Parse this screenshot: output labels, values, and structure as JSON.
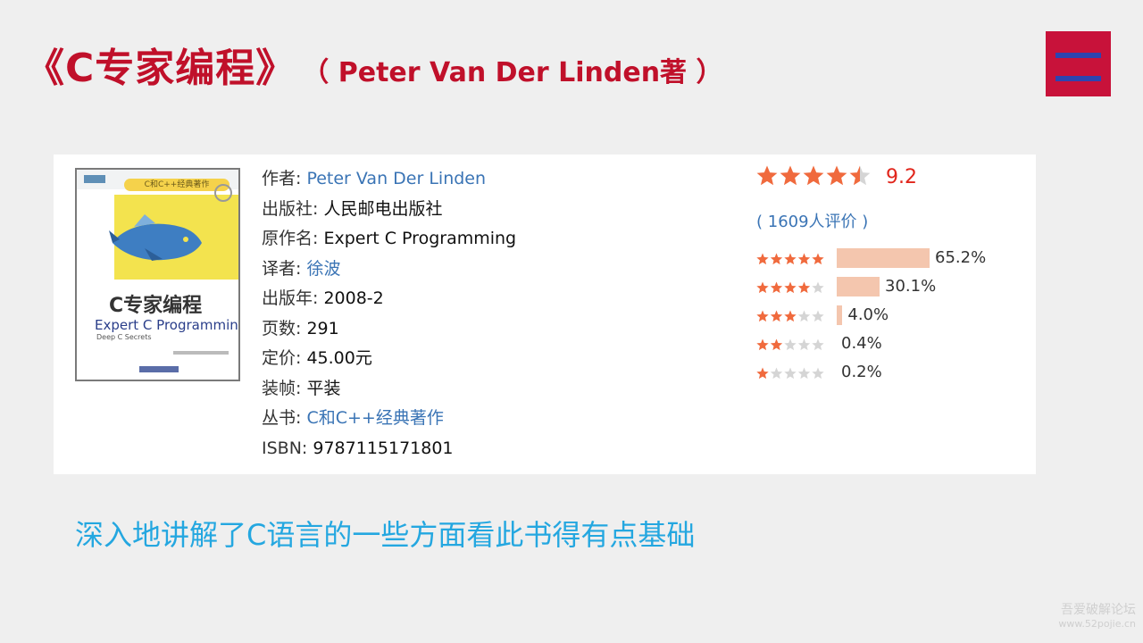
{
  "slide": {
    "title": "《C专家编程》",
    "subtitle": "（ Peter Van Der Linden著 ）",
    "caption": "深入地讲解了C语言的一些方面看此书得有点基础"
  },
  "cover": {
    "series_tag": "C和C++经典著作",
    "title_cn": "C专家编程",
    "title_en": "Expert C Programming",
    "title_sub": "Deep C Secrets"
  },
  "book_info": {
    "rows": [
      {
        "label": "作者:",
        "value": "Peter Van Der Linden",
        "link": true
      },
      {
        "label": "出版社:",
        "value": "人民邮电出版社",
        "link": false
      },
      {
        "label": "原作名:",
        "value": "Expert C Programming",
        "link": false
      },
      {
        "label": "译者:",
        "value": "徐波",
        "link": true
      },
      {
        "label": "出版年:",
        "value": "2008-2",
        "link": false
      },
      {
        "label": "页数:",
        "value": "291",
        "link": false
      },
      {
        "label": "定价:",
        "value": "45.00元",
        "link": false
      },
      {
        "label": "装帧:",
        "value": "平装",
        "link": false
      },
      {
        "label": "丛书:",
        "value": "C和C++经典著作",
        "link": true
      },
      {
        "label": "ISBN:",
        "value": "9787115171801",
        "link": false
      }
    ]
  },
  "rating": {
    "score": "9.2",
    "stars": 4.5,
    "votes_text": "( 1609人评价 )",
    "distribution": [
      {
        "stars": 5,
        "percent": 65.2,
        "label": "65.2%"
      },
      {
        "stars": 4,
        "percent": 30.1,
        "label": "30.1%"
      },
      {
        "stars": 3,
        "percent": 4.0,
        "label": "4.0%"
      },
      {
        "stars": 2,
        "percent": 0.4,
        "label": "0.4%"
      },
      {
        "stars": 1,
        "percent": 0.2,
        "label": "0.2%"
      }
    ]
  },
  "watermark": {
    "line1": "吾爱破解论坛",
    "line2": "www.52pojie.cn"
  },
  "colors": {
    "title_red": "#c0102a",
    "badge_red": "#c8123a",
    "badge_bar_blue": "#2d44b0",
    "caption_blue": "#24a7e0",
    "link_blue": "#3a74b5",
    "star_orange": "#f06a3d",
    "star_empty": "#d5d5d5",
    "score_red": "#e1251b",
    "dist_bar": "#f4c6ae"
  },
  "icons": {
    "corner_badge": "menu-icon",
    "rating": "star-icon"
  }
}
